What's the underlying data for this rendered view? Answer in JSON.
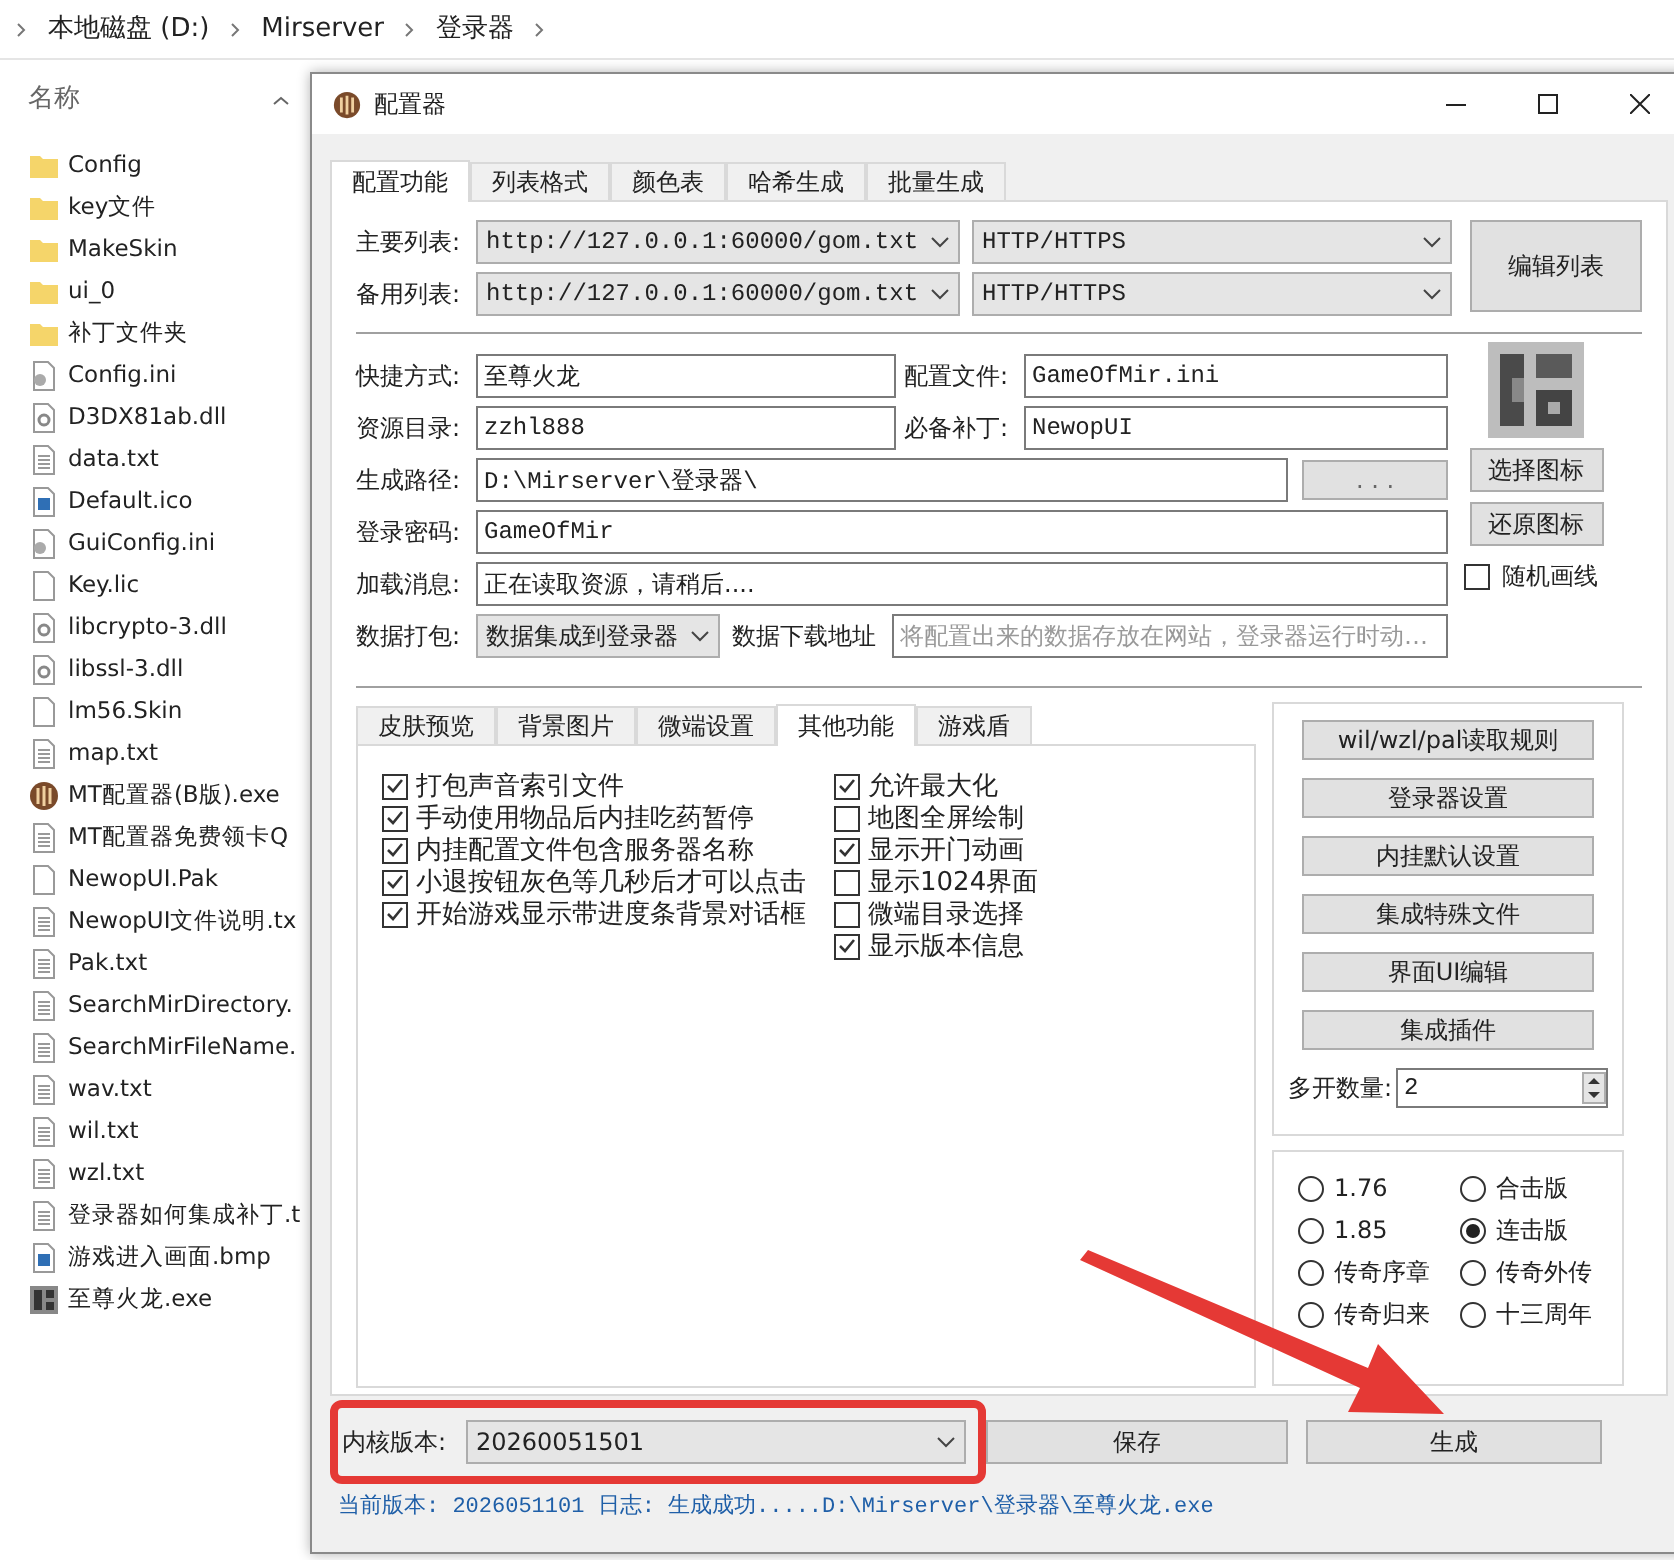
{
  "breadcrumb": [
    "本地磁盘 (D:)",
    "Mirserver",
    "登录器"
  ],
  "explorer": {
    "column_header": "名称",
    "files": [
      {
        "name": "Config",
        "kind": "folder"
      },
      {
        "name": "key文件",
        "kind": "folder"
      },
      {
        "name": "MakeSkin",
        "kind": "folder"
      },
      {
        "name": "ui_0",
        "kind": "folder"
      },
      {
        "name": "补丁文件夹",
        "kind": "folder"
      },
      {
        "name": "Config.ini",
        "kind": "settings"
      },
      {
        "name": "D3DX81ab.dll",
        "kind": "dll"
      },
      {
        "name": "data.txt",
        "kind": "text"
      },
      {
        "name": "Default.ico",
        "kind": "image"
      },
      {
        "name": "GuiConfig.ini",
        "kind": "settings"
      },
      {
        "name": "Key.lic",
        "kind": "blank"
      },
      {
        "name": "libcrypto-3.dll",
        "kind": "dll"
      },
      {
        "name": "libssl-3.dll",
        "kind": "dll"
      },
      {
        "name": "lm56.Skin",
        "kind": "blank"
      },
      {
        "name": "map.txt",
        "kind": "text"
      },
      {
        "name": "MT配置器(B版).exe",
        "kind": "app"
      },
      {
        "name": "MT配置器免费领卡Q",
        "kind": "text"
      },
      {
        "name": "NewopUI.Pak",
        "kind": "blank"
      },
      {
        "name": "NewopUI文件说明.tx",
        "kind": "text"
      },
      {
        "name": "Pak.txt",
        "kind": "text"
      },
      {
        "name": "SearchMirDirectory.",
        "kind": "text"
      },
      {
        "name": "SearchMirFileName.",
        "kind": "text"
      },
      {
        "name": "wav.txt",
        "kind": "text"
      },
      {
        "name": "wil.txt",
        "kind": "text"
      },
      {
        "name": "wzl.txt",
        "kind": "text"
      },
      {
        "name": "登录器如何集成补丁.t",
        "kind": "text"
      },
      {
        "name": "游戏进入画面.bmp",
        "kind": "image"
      },
      {
        "name": "至尊火龙.exe",
        "kind": "exe"
      }
    ]
  },
  "dialog": {
    "title": "配置器",
    "tabs": [
      {
        "label": "配置功能",
        "selected": true
      },
      {
        "label": "列表格式",
        "selected": false
      },
      {
        "label": "颜色表",
        "selected": false
      },
      {
        "label": "哈希生成",
        "selected": false
      },
      {
        "label": "批量生成",
        "selected": false
      }
    ],
    "list_rows": [
      {
        "label": "主要列表:",
        "url": "http://127.0.0.1:60000/gom.txt",
        "protocol": "HTTP/HTTPS"
      },
      {
        "label": "备用列表:",
        "url": "http://127.0.0.1:60000/gom.txt",
        "protocol": "HTTP/HTTPS"
      }
    ],
    "edit_list_button": "编辑列表",
    "shortcut": {
      "label": "快捷方式:",
      "value": "至尊火龙"
    },
    "config_file": {
      "label": "配置文件:",
      "value": "GameOfMir.ini"
    },
    "resource_dir": {
      "label": "资源目录:",
      "value": "zzhl888"
    },
    "required_patch": {
      "label": "必备补丁:",
      "value": "NewopUI"
    },
    "output_path": {
      "label": "生成路径:",
      "value": "D:\\Mirserver\\登录器\\",
      "browse_button": ". . ."
    },
    "password": {
      "label": "登录密码:",
      "value": "GameOfMir"
    },
    "loading_message": {
      "label": "加载消息:",
      "value": "正在读取资源，请稍后...."
    },
    "data_pack": {
      "label": "数据打包:",
      "value": "数据集成到登录器"
    },
    "download_url": {
      "label": "数据下载地址",
      "placeholder": "将配置出来的数据存放在网站，登录器运行时动…"
    },
    "icon_buttons": [
      "选择图标",
      "还原图标"
    ],
    "random_lines": {
      "label": "随机画线",
      "checked": false
    },
    "sub_tabs": [
      {
        "label": "皮肤预览",
        "selected": false
      },
      {
        "label": "背景图片",
        "selected": false
      },
      {
        "label": "微端设置",
        "selected": false
      },
      {
        "label": "其他功能",
        "selected": true
      },
      {
        "label": "游戏盾",
        "selected": false
      }
    ],
    "options_left": [
      {
        "label": "打包声音索引文件",
        "checked": true
      },
      {
        "label": "手动使用物品后内挂吃药暂停",
        "checked": true
      },
      {
        "label": "内挂配置文件包含服务器名称",
        "checked": true
      },
      {
        "label": "小退按钮灰色等几秒后才可以点击",
        "checked": true
      },
      {
        "label": "开始游戏显示带进度条背景对话框",
        "checked": true
      }
    ],
    "options_right": [
      {
        "label": "允许最大化",
        "checked": true
      },
      {
        "label": "地图全屏绘制",
        "checked": false
      },
      {
        "label": "显示开门动画",
        "checked": true
      },
      {
        "label": "显示1024界面",
        "checked": false
      },
      {
        "label": "微端目录选择",
        "checked": false
      },
      {
        "label": "显示版本信息",
        "checked": true
      }
    ],
    "side_buttons": [
      "wil/wzl/pal读取规则",
      "登录器设置",
      "内挂默认设置",
      "集成特殊文件",
      "界面UI编辑",
      "集成插件"
    ],
    "instances": {
      "label": "多开数量:",
      "value": "2"
    },
    "versions": [
      {
        "label": "1.76",
        "selected": false
      },
      {
        "label": "合击版",
        "selected": false
      },
      {
        "label": "1.85",
        "selected": false
      },
      {
        "label": "连击版",
        "selected": true
      },
      {
        "label": "传奇序章",
        "selected": false
      },
      {
        "label": "传奇外传",
        "selected": false
      },
      {
        "label": "传奇归来",
        "selected": false
      },
      {
        "label": "十三周年",
        "selected": false
      }
    ],
    "core_version": {
      "label": "内核版本:",
      "value": "20260051501"
    },
    "save_button": "保存",
    "generate_button": "生成",
    "status": "当前版本:  2026051101 日志: 生成成功.....D:\\Mirserver\\登录器\\至尊火龙.exe"
  }
}
